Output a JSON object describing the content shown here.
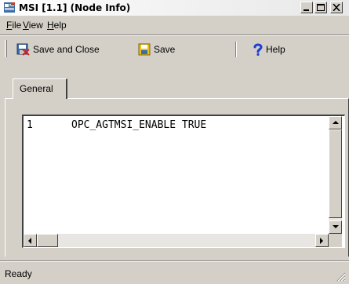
{
  "window": {
    "title": "MSI [1.1]  (Node Info)"
  },
  "menu": {
    "file_first": "F",
    "file_rest": "ile",
    "view_first": "V",
    "view_rest": "iew",
    "help_first": "H",
    "help_rest": "elp"
  },
  "toolbar": {
    "save_close_label": "Save and Close",
    "save_label": "Save",
    "help_label": "Help"
  },
  "tabs": [
    {
      "label": "General",
      "selected": true
    }
  ],
  "editor": {
    "lines": [
      {
        "number": "1",
        "text": "OPC_AGTMSI_ENABLE TRUE"
      }
    ]
  },
  "status": {
    "text": "Ready"
  },
  "colors": {
    "face": "#d4d0c8",
    "editor_bg": "#ffffff",
    "help_icon": "#1a3fd6"
  }
}
